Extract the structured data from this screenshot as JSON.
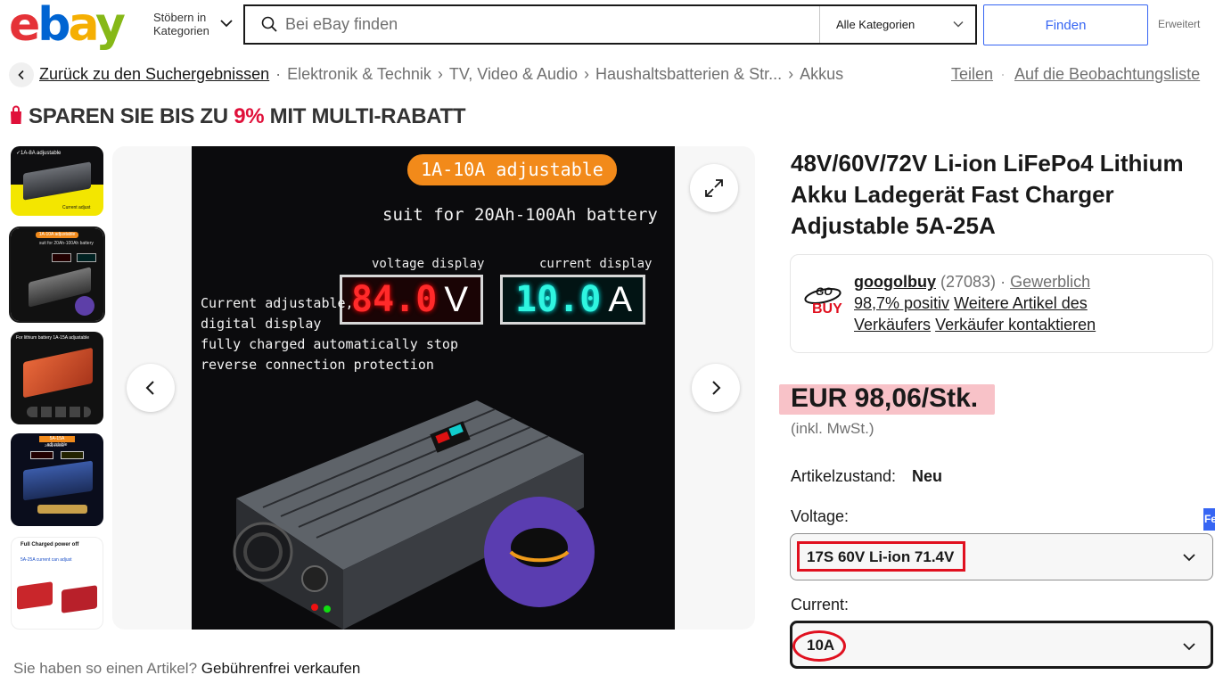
{
  "header": {
    "logo_letters": [
      "e",
      "b",
      "a",
      "y"
    ],
    "browse_line1": "Stöbern in",
    "browse_line2": "Kategorien",
    "search_placeholder": "Bei eBay finden",
    "category_label": "Alle Kategorien",
    "find_label": "Finden",
    "advanced_label": "Erweitert"
  },
  "breadcrumb": {
    "back_label": "Zurück zu den Suchergebnissen",
    "items": [
      "Elektronik & Technik",
      "TV, Video & Audio",
      "Haushaltsbatterien & Str...",
      "Akkus"
    ],
    "share_label": "Teilen",
    "separator": "·",
    "watch_label": "Auf die Beobachtungsliste"
  },
  "promo": {
    "prefix": "SPAREN SIE BIS ZU ",
    "percent": "9%",
    "suffix": " MIT MULTI-RABATT"
  },
  "gallery": {
    "hero": {
      "badge": "1A-10A adjustable",
      "subtitle": "suit for 20Ah-100Ah battery",
      "voltage_caption": "voltage display",
      "current_caption": "current display",
      "voltage_value": "84.0",
      "voltage_unit": "V",
      "current_value": "10.0",
      "current_unit": "A",
      "features": [
        "Current adjustable,",
        "digital display",
        "fully charged automatically stop",
        "reverse connection protection"
      ]
    },
    "thumbs": [
      {
        "text1": "✓1A-8A adjustable",
        "text2": "Current adjust"
      },
      {
        "text1": "1A-10A adjustable",
        "text2": "suit for 20Ah-100Ah battery"
      },
      {
        "text1": "For lithium battery 1A-15A adjustable",
        "text2": ""
      },
      {
        "text1": "5A-15A adjustable",
        "text2": "20Ah-150Ah"
      },
      {
        "text1": "Full Charged power off",
        "text2": "5A-25A current can adjust"
      }
    ]
  },
  "product": {
    "title": "48V/60V/72V Li-ion LiFePo4 Lithium Akku Ladegerät Fast Charger Adjustable 5A-25A",
    "seller": {
      "logo_top": "GO",
      "logo_bottom": "BUY",
      "name": "googolbuy",
      "count": "(27083)",
      "dot": "·",
      "type": "Gewerblich",
      "positive": "98,7% positiv",
      "more_line1": "Weitere Artikel des",
      "more_line2": "Verkäufers",
      "contact": "Verkäufer kontaktieren"
    },
    "price": "EUR 98,06/Stk.",
    "vat": "(inkl. MwSt.)",
    "condition_label": "Artikelzustand:",
    "condition_value": "Neu",
    "voltage_label": "Voltage:",
    "voltage_value": "17S 60V Li-ion 71.4V",
    "current_label": "Current:",
    "current_value": "10A",
    "side_tab": "Fe"
  },
  "footer": {
    "sell_question": "Sie haben so einen Artikel? ",
    "sell_link": "Gebührenfrei verkaufen"
  },
  "colors": {
    "accent": "#3665f3",
    "highlight_red": "#e0101f",
    "price_highlight": "#f8c2c8"
  }
}
